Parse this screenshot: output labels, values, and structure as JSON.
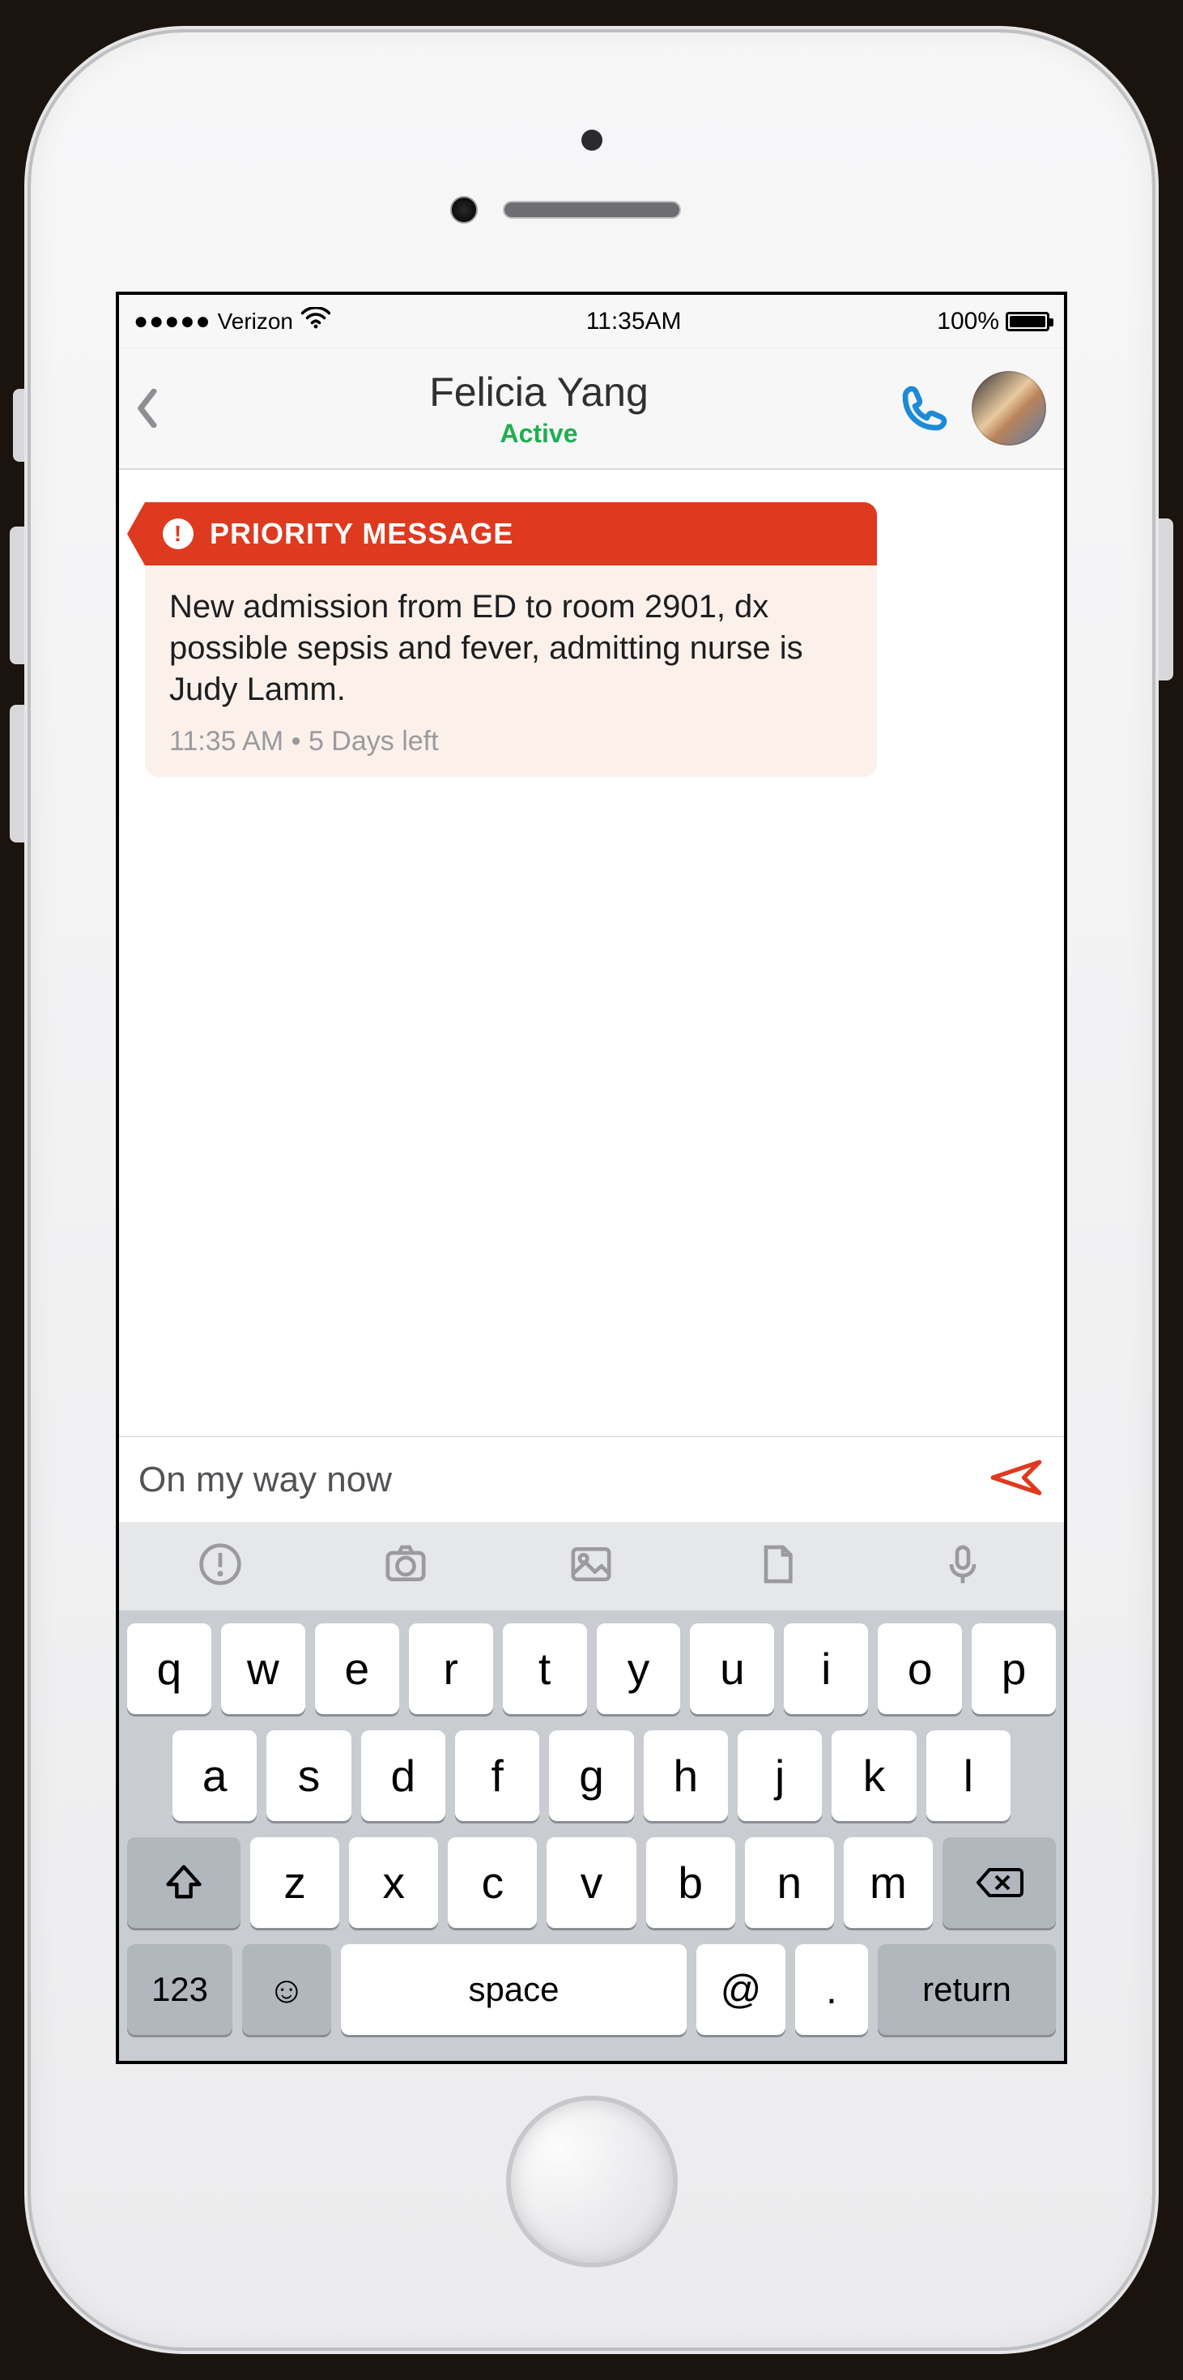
{
  "status": {
    "signal_dots": "●●●●●",
    "carrier": "Verizon",
    "time": "11:35AM",
    "battery_pct": "100%"
  },
  "header": {
    "contact_name": "Felicia Yang",
    "presence": "Active"
  },
  "message": {
    "priority_label": "PRIORITY MESSAGE",
    "body": "New admission from ED to room 2901, dx possible sepsis and fever, admitting nurse is Judy Lamm.",
    "time": "11:35 AM",
    "expiry": "5 Days left"
  },
  "compose": {
    "draft": "On my way now"
  },
  "keyboard": {
    "row1": [
      "q",
      "w",
      "e",
      "r",
      "t",
      "y",
      "u",
      "i",
      "o",
      "p"
    ],
    "row2": [
      "a",
      "s",
      "d",
      "f",
      "g",
      "h",
      "j",
      "k",
      "l"
    ],
    "row3": [
      "z",
      "x",
      "c",
      "v",
      "b",
      "n",
      "m"
    ],
    "num_label": "123",
    "space_label": "space",
    "at_label": "@",
    "dot_label": ".",
    "return_label": "return"
  }
}
